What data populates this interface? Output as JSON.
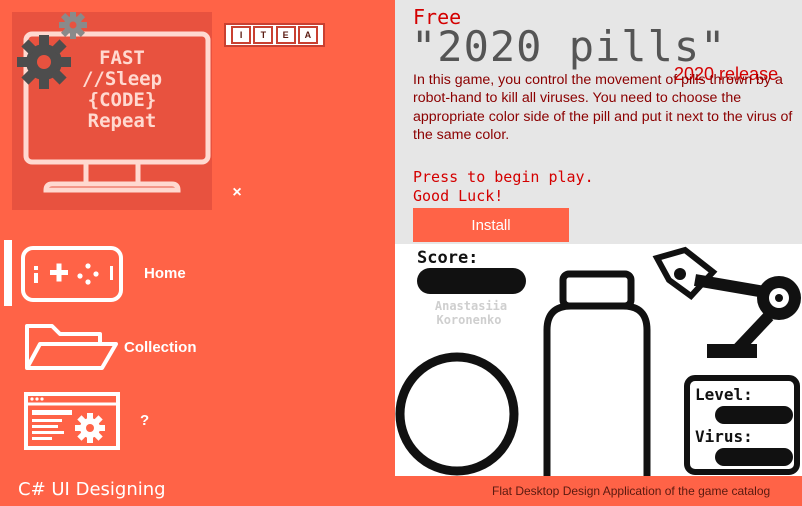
{
  "logo": {
    "screen_lines": [
      "FAST",
      "//Sleep",
      "{CODE}",
      "Repeat"
    ]
  },
  "itea_badge": {
    "letters": [
      "I",
      "T",
      "E",
      "A"
    ]
  },
  "close_button": {
    "glyph": "×"
  },
  "nav": {
    "items": [
      {
        "label": "Home",
        "icon": "gamepad-phone-icon",
        "active": true
      },
      {
        "label": "Collection",
        "icon": "folder-icon",
        "active": false
      },
      {
        "label": "?",
        "icon": "browser-gear-icon",
        "active": false
      }
    ]
  },
  "footer": {
    "left": "C# UI Designing",
    "right": "Flat Desktop Design Application of the game catalog"
  },
  "game": {
    "free_label": "Free",
    "title": "\"2020 pills\"",
    "release": "2020 release",
    "description": "In this game, you control the movement of pills thrown by a robot-hand to kill all viruses. You need to choose the  appropriate color side of the pill and put it next to the virus  of the same color.",
    "press_text": "Press to begin play.",
    "luck_text": "Good Luck!",
    "install_label": "Install"
  },
  "preview": {
    "score_label": "Score:",
    "author_first": "Anastasiia",
    "author_last": "Koronenko",
    "level_label": "Level:",
    "virus_label": "Virus:"
  },
  "colors": {
    "accent": "#ff6347",
    "panel": "#e6e6e6",
    "title_red": "#d40000",
    "desc_dark_red": "#8b0000"
  }
}
